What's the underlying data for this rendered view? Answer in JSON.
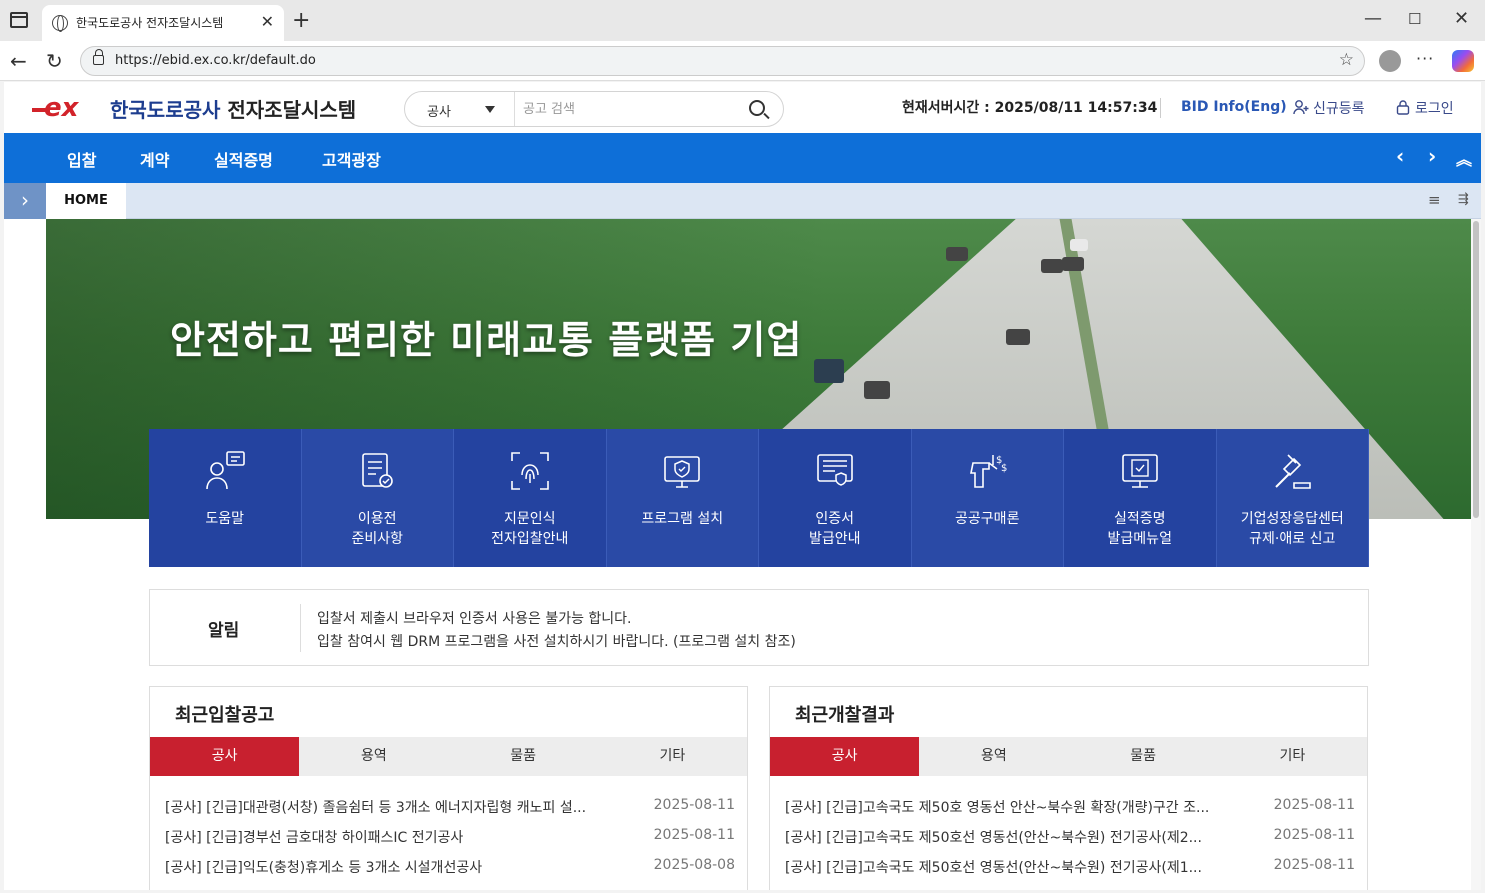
{
  "browser": {
    "tab_title": "한국도로공사 전자조달시스템",
    "url": "https://ebid.ex.co.kr/default.do"
  },
  "header": {
    "logo_mark": "ex",
    "logo_name": "한국도로공사",
    "logo_sub": "전자조달시스템",
    "search_category": "공사",
    "search_placeholder": "공고 검색",
    "server_time_label": "현재서버시간 : ",
    "server_time_value": "2025/08/11 14:57:34",
    "bid_eng": "BID Info(Eng)",
    "signup": "신규등록",
    "login": "로그인"
  },
  "nav": {
    "items": [
      "입찰",
      "계약",
      "실적증명",
      "고객광장"
    ]
  },
  "tabstrip": {
    "home": "HOME"
  },
  "banner": {
    "slogan": "안전하고 편리한 미래교통 플랫폼 기업"
  },
  "quick_links": [
    {
      "label": "도움말",
      "icon": "help-person-icon"
    },
    {
      "label": "이용전\n준비사항",
      "icon": "checklist-icon"
    },
    {
      "label": "지문인식\n전자입찰안내",
      "icon": "fingerprint-icon"
    },
    {
      "label": "프로그램 설치",
      "icon": "monitor-shield-icon"
    },
    {
      "label": "인증서\n발급안내",
      "icon": "certificate-icon"
    },
    {
      "label": "공공구매론",
      "icon": "hand-coin-icon"
    },
    {
      "label": "실적증명\n발급메뉴얼",
      "icon": "monitor-doc-icon"
    },
    {
      "label": "기업성장응답센터\n규제·애로 신고",
      "icon": "gavel-icon"
    }
  ],
  "notice": {
    "label": "알림",
    "lines": [
      "입찰서 제출시 브라우저 인증서 사용은 불가능 합니다.",
      "입찰 참여시 웹 DRM 프로그램을 사전 설치하시기 바랍니다. (프로그램 설치 참조)"
    ]
  },
  "recent_bids": {
    "title": "최근입찰공고",
    "tabs": [
      "공사",
      "용역",
      "물품",
      "기타"
    ],
    "rows": [
      {
        "title": "[공사] [긴급]대관령(서창) 졸음쉼터 등 3개소 에너지자립형 캐노피 설...",
        "date": "2025-08-11"
      },
      {
        "title": "[공사] [긴급]경부선 금호대창 하이패스IC 전기공사",
        "date": "2025-08-11"
      },
      {
        "title": "[공사] [긴급]익도(충청)휴게소 등 3개소 시설개선공사",
        "date": "2025-08-08"
      }
    ]
  },
  "recent_results": {
    "title": "최근개찰결과",
    "tabs": [
      "공사",
      "용역",
      "물품",
      "기타"
    ],
    "rows": [
      {
        "title": "[공사] [긴급]고속국도 제50호 영동선 안산~북수원 확장(개량)구간 조...",
        "date": "2025-08-11"
      },
      {
        "title": "[공사] [긴급]고속국도 제50호선 영동선(안산~북수원) 전기공사(제2...",
        "date": "2025-08-11"
      },
      {
        "title": "[공사] [긴급]고속국도 제50호선 영동선(안산~북수원) 전기공사(제1...",
        "date": "2025-08-11"
      }
    ]
  },
  "colors": {
    "nav_blue": "#0e6fd8",
    "quick_blue": "#2a4aa6",
    "active_red": "#c8202f",
    "logo_red": "#d2232a",
    "logo_navy": "#1d3d8f"
  }
}
